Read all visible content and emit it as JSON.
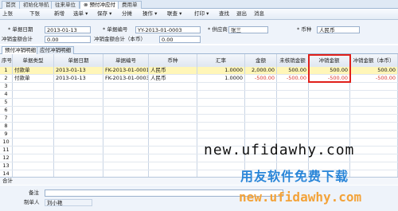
{
  "tabs": [
    "首页",
    "初始化导航",
    "往来单位",
    "预付冲应付",
    "费用单"
  ],
  "toolbar": [
    "上张",
    "下张",
    "新增",
    "选单",
    "保存",
    "分摊",
    "操作",
    "联查",
    "打印",
    "查找",
    "退出",
    "消息"
  ],
  "form": {
    "doc_date_label": "单据日期",
    "doc_date": "2013-01-13",
    "doc_no_label": "单据编号",
    "doc_no": "YY-2013-01-0003",
    "supplier_label": "供应商",
    "supplier": "张三",
    "currency_label": "币种",
    "currency": "人民币",
    "offset_amount_label": "冲销金额合计",
    "offset_amount": "0.00",
    "offset_local_label": "冲销金额合计（本币）",
    "offset_local": "0.00"
  },
  "subtabs": [
    "预付冲销明细",
    "应付冲销明细"
  ],
  "grid": {
    "headers": [
      "序号",
      "单据类型",
      "单据日期",
      "单据编号",
      "币种",
      "汇率",
      "金额",
      "未核销金额",
      "冲销金额",
      "冲销金额（本币）"
    ],
    "rows": [
      [
        "1",
        "付款单",
        "2013-01-13",
        "FK-2013-01-0001",
        "人民币",
        "1.0000",
        "2,000.00",
        "500.00",
        "500.00",
        "500.00"
      ],
      [
        "2",
        "付款单",
        "2013-01-13",
        "FK-2013-01-0003",
        "人民币",
        "1.0000",
        "-500.00",
        "-500.00",
        "-500.00",
        "-500.00"
      ]
    ],
    "row_numbers": [
      "3",
      "4",
      "5",
      "6",
      "7",
      "8",
      "9",
      "10",
      "11",
      "12",
      "13",
      "14"
    ],
    "total_label": "合计"
  },
  "footer": {
    "remark_label": "备注",
    "maker_label": "制单人",
    "maker": "刘小艳"
  },
  "watermark": {
    "url": "new.ufidawhy.com",
    "cn": "用友软件免费下载",
    "url2": "new.ufidawhy.com"
  },
  "colors": {
    "highlight": "#e0201a",
    "negative": "#d9342a",
    "selected_row": "#fff6b8"
  }
}
